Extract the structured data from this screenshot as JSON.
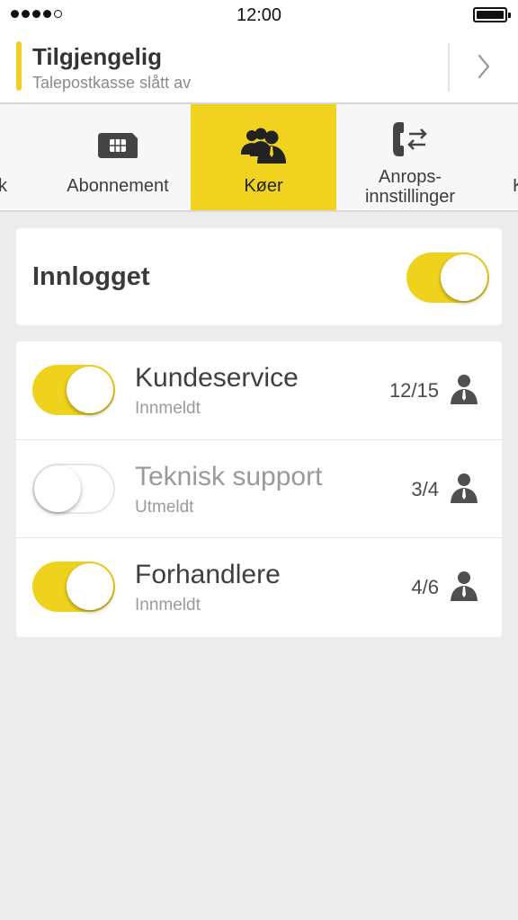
{
  "statusbar": {
    "time": "12:00",
    "signal_bars": 4,
    "signal_total": 5
  },
  "header": {
    "title": "Tilgjengelig",
    "subtitle": "Talepostkasse slått av",
    "accent_color": "#f0d020"
  },
  "tabs": [
    {
      "label": "k",
      "icon": "partial-icon",
      "active": false
    },
    {
      "label": "Abonnement",
      "icon": "sim-card-icon",
      "active": false
    },
    {
      "label": "Køer",
      "icon": "group-people-icon",
      "active": true
    },
    {
      "label_line1": "Anrops-",
      "label_line2": "innstillinger",
      "icon": "phone-transfer-icon",
      "active": false
    },
    {
      "label": "K",
      "icon": "partial-icon",
      "active": false
    }
  ],
  "login": {
    "label": "Innlogget",
    "on": true
  },
  "queues": [
    {
      "name": "Kundeservice",
      "status": "Innmeldt",
      "count": "12/15",
      "on": true
    },
    {
      "name": "Teknisk support",
      "status": "Utmeldt",
      "count": "3/4",
      "on": false
    },
    {
      "name": "Forhandlere",
      "status": "Innmeldt",
      "count": "4/6",
      "on": true
    }
  ],
  "colors": {
    "accent": "#f1d31f",
    "background": "#ececec",
    "text": "#333333"
  }
}
